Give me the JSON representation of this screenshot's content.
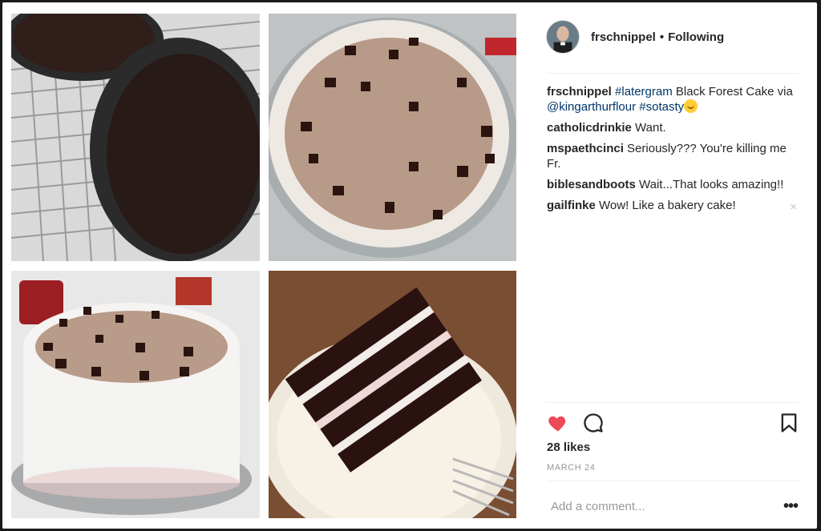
{
  "post": {
    "username": "frschnippel",
    "separator": "•",
    "follow_status": "Following",
    "caption": {
      "user": "frschnippel",
      "text_parts": [
        {
          "type": "tag",
          "text": "#latergram"
        },
        {
          "type": "text",
          "text": " Black Forest Cake via "
        },
        {
          "type": "tag",
          "text": "@kingarthurflour"
        },
        {
          "type": "text",
          "text": " "
        },
        {
          "type": "tag",
          "text": "#sotasty"
        }
      ],
      "emoji": "smiling-face-emoji"
    },
    "comments": [
      {
        "user": "catholicdrinkie",
        "text": "Want."
      },
      {
        "user": "mspaethcinci",
        "text": "Seriously??? You're killing me Fr."
      },
      {
        "user": "biblesandboots",
        "text": "Wait...That looks amazing!!"
      },
      {
        "user": "gailfinke",
        "text": "Wow! Like a bakery cake!",
        "delete_icon": "×"
      }
    ],
    "likes": "28 likes",
    "date": "MARCH 24",
    "add_comment_placeholder": "Add a comment...",
    "more_options": "•••"
  },
  "icons": {
    "like": "heart-icon",
    "comment": "comment-bubble-icon",
    "save": "bookmark-icon"
  },
  "colors": {
    "like_red": "#ed4956",
    "text": "#262626",
    "link": "#003569",
    "muted": "#999999"
  }
}
